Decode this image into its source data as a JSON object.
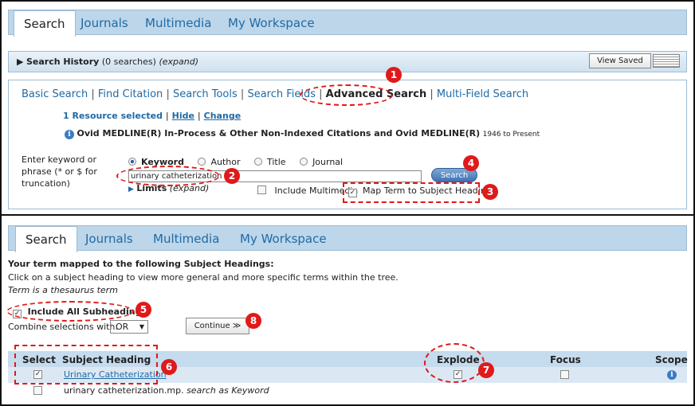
{
  "top_panel": {
    "tabs": [
      {
        "label": "Search",
        "active": true
      },
      {
        "label": "Journals"
      },
      {
        "label": "Multimedia"
      },
      {
        "label": "My Workspace"
      }
    ],
    "history": {
      "title": "Search History",
      "count": "(0 searches)",
      "expand": "(expand)",
      "view_saved": "View Saved"
    },
    "search_modes": [
      "Basic Search",
      "Find Citation",
      "Search Tools",
      "Search Fields",
      "Advanced Search",
      "Multi-Field Search"
    ],
    "resource": {
      "selected": "1 Resource selected",
      "hide": "Hide",
      "change": "Change",
      "database": "Ovid MEDLINE(R) In-Process & Other Non-Indexed Citations and Ovid MEDLINE(R)",
      "range": "1946 to Present"
    },
    "keyword_label": "Enter keyword or phrase (* or $ for truncation)",
    "radios": [
      "Keyword",
      "Author",
      "Title",
      "Journal"
    ],
    "search_value": "urinary catheterization",
    "search_button": "Search",
    "limits": "Limits",
    "limits_expand": "(expand)",
    "include_multimedia": "Include Multimedia",
    "map_term": "Map Term to Subject Heading"
  },
  "bottom_panel": {
    "tabs": [
      {
        "label": "Search",
        "active": true
      },
      {
        "label": "Journals"
      },
      {
        "label": "Multimedia"
      },
      {
        "label": "My Workspace"
      }
    ],
    "mapped_heading": "Your term mapped to the following Subject Headings:",
    "instruction": "Click on a subject heading to view more general and more specific terms within the tree.",
    "thesaurus_note": "Term is a thesaurus term",
    "include_all": "Include All Subheadings",
    "combine_label": "Combine selections with:",
    "combine_value": "OR",
    "continue_button": "Continue ≫",
    "columns": [
      "Select",
      "Subject Heading",
      "Explode",
      "Focus",
      "Scope"
    ],
    "rows": [
      {
        "heading": "Urinary Catheterization",
        "checked": true,
        "explode": true
      },
      {
        "heading": "urinary catheterization.mp.",
        "suffix": "search as Keyword"
      }
    ]
  },
  "callouts": [
    "1",
    "2",
    "3",
    "4",
    "5",
    "6",
    "7",
    "8"
  ],
  "colors": {
    "tab_bar": "#bdd6ea",
    "link": "#1f6aa5",
    "callout": "#e0191a",
    "header_row": "#c5dbee"
  }
}
